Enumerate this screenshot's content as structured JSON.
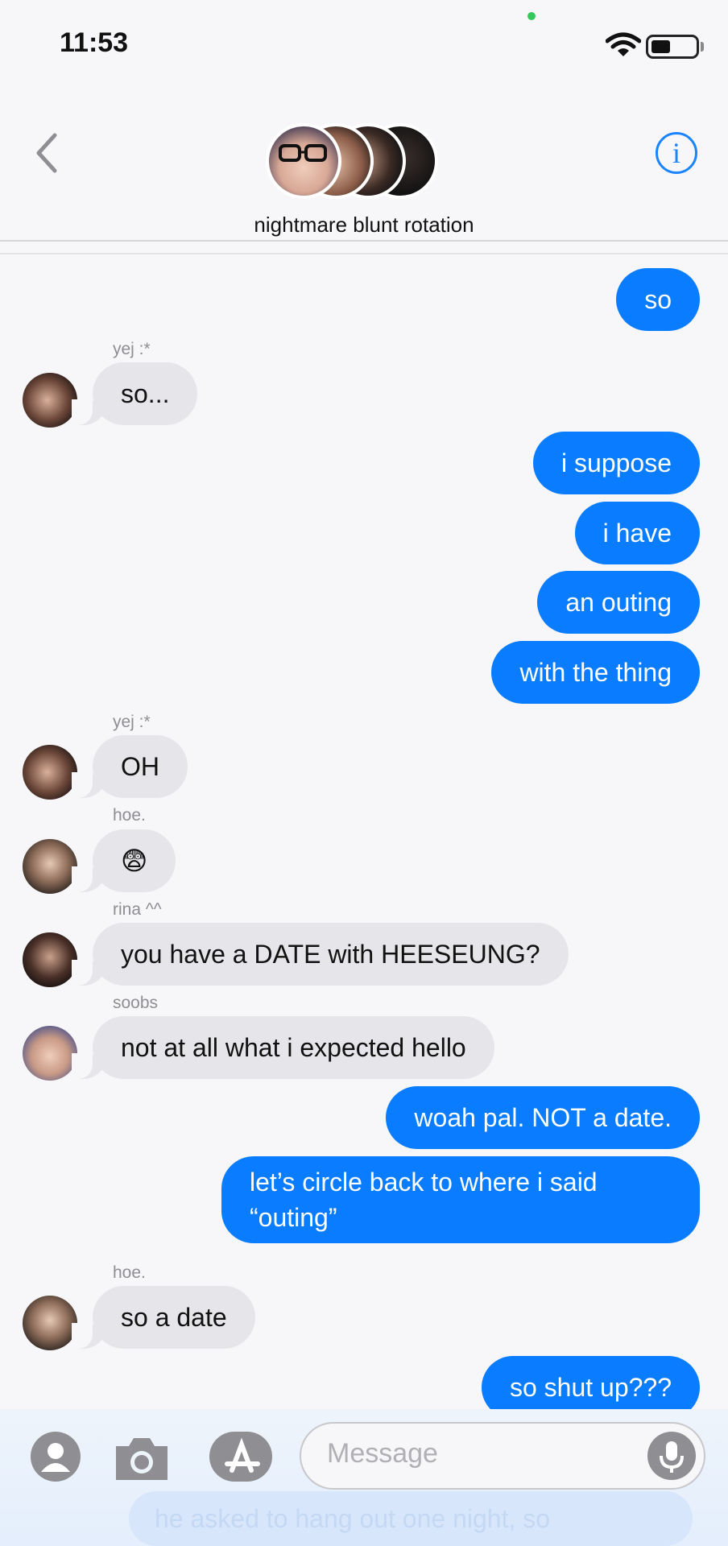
{
  "status": {
    "time": "11:53",
    "battery_level": 0.45
  },
  "header": {
    "title": "nightmare blunt rotation",
    "info_glyph": "i"
  },
  "colors": {
    "accent": "#0a7cff",
    "incoming_bubble": "#e6e5ea",
    "background": "#f7f7f9"
  },
  "messages": [
    {
      "dir": "out",
      "text": "so"
    },
    {
      "dir": "in",
      "sender": "yej :*",
      "text": "so..."
    },
    {
      "dir": "out",
      "text": "i suppose"
    },
    {
      "dir": "out",
      "text": "i have"
    },
    {
      "dir": "out",
      "text": "an outing"
    },
    {
      "dir": "out",
      "text": "with the thing"
    },
    {
      "dir": "in",
      "sender": "yej :*",
      "text": "OH"
    },
    {
      "dir": "in",
      "sender": "hoe.",
      "text": "😨"
    },
    {
      "dir": "in",
      "sender": "rina ^^",
      "text": "you have a DATE with HEESEUNG?"
    },
    {
      "dir": "in",
      "sender": "soobs",
      "text": "not at all what i expected hello"
    },
    {
      "dir": "out",
      "text": "woah pal. NOT a date."
    },
    {
      "dir": "out",
      "text": "let’s circle back to where i said “outing”"
    },
    {
      "dir": "in",
      "sender": "hoe.",
      "text": "so a date"
    },
    {
      "dir": "out",
      "text": "so shut up???"
    }
  ],
  "composer": {
    "placeholder": "Message",
    "ghost_text": "he asked to hang out one night, so",
    "icons": [
      "contact-icon",
      "camera-icon",
      "app-store-icon",
      "microphone-icon"
    ]
  }
}
